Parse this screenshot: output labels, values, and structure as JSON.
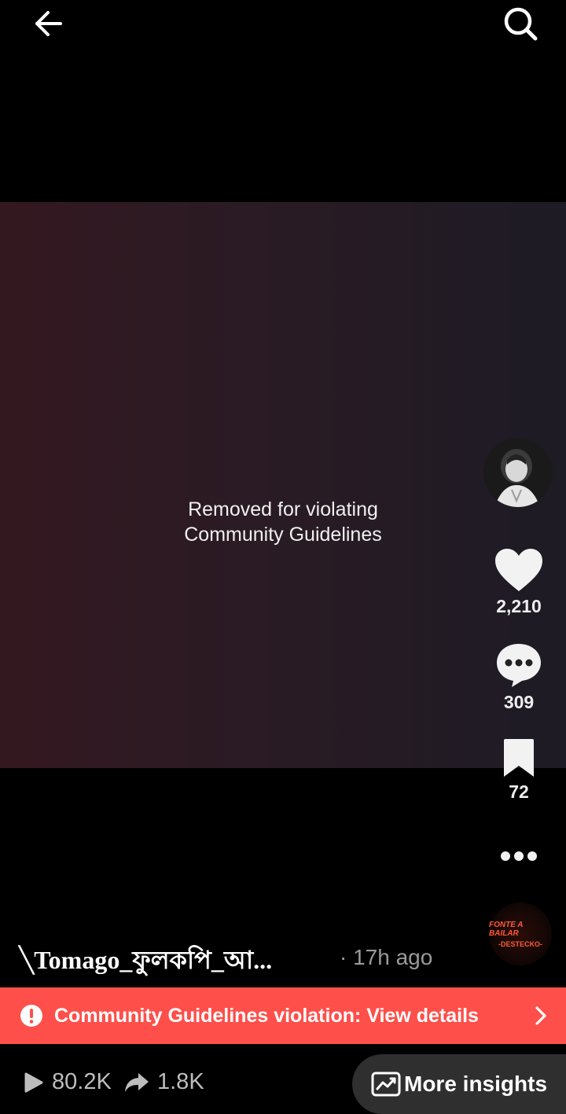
{
  "header": {
    "back_icon": "arrow-left-icon",
    "search_icon": "search-icon"
  },
  "video": {
    "removed_line1": "Removed for violating",
    "removed_line2": "Community Guidelines"
  },
  "rail": {
    "likes": "2,210",
    "comments": "309",
    "saves": "72",
    "sound_disc_text1": "FONTE A BAILAR",
    "sound_disc_text2": "-DESTECKO-"
  },
  "post": {
    "author": "╲Tomago_ফুলকপি_আ...",
    "timestamp": "· 17h ago"
  },
  "banner": {
    "text": "Community Guidelines violation: View details",
    "color": "#fe4f4a"
  },
  "footer": {
    "views": "80.2K",
    "shares": "1.8K",
    "insights_label": "More insights"
  }
}
